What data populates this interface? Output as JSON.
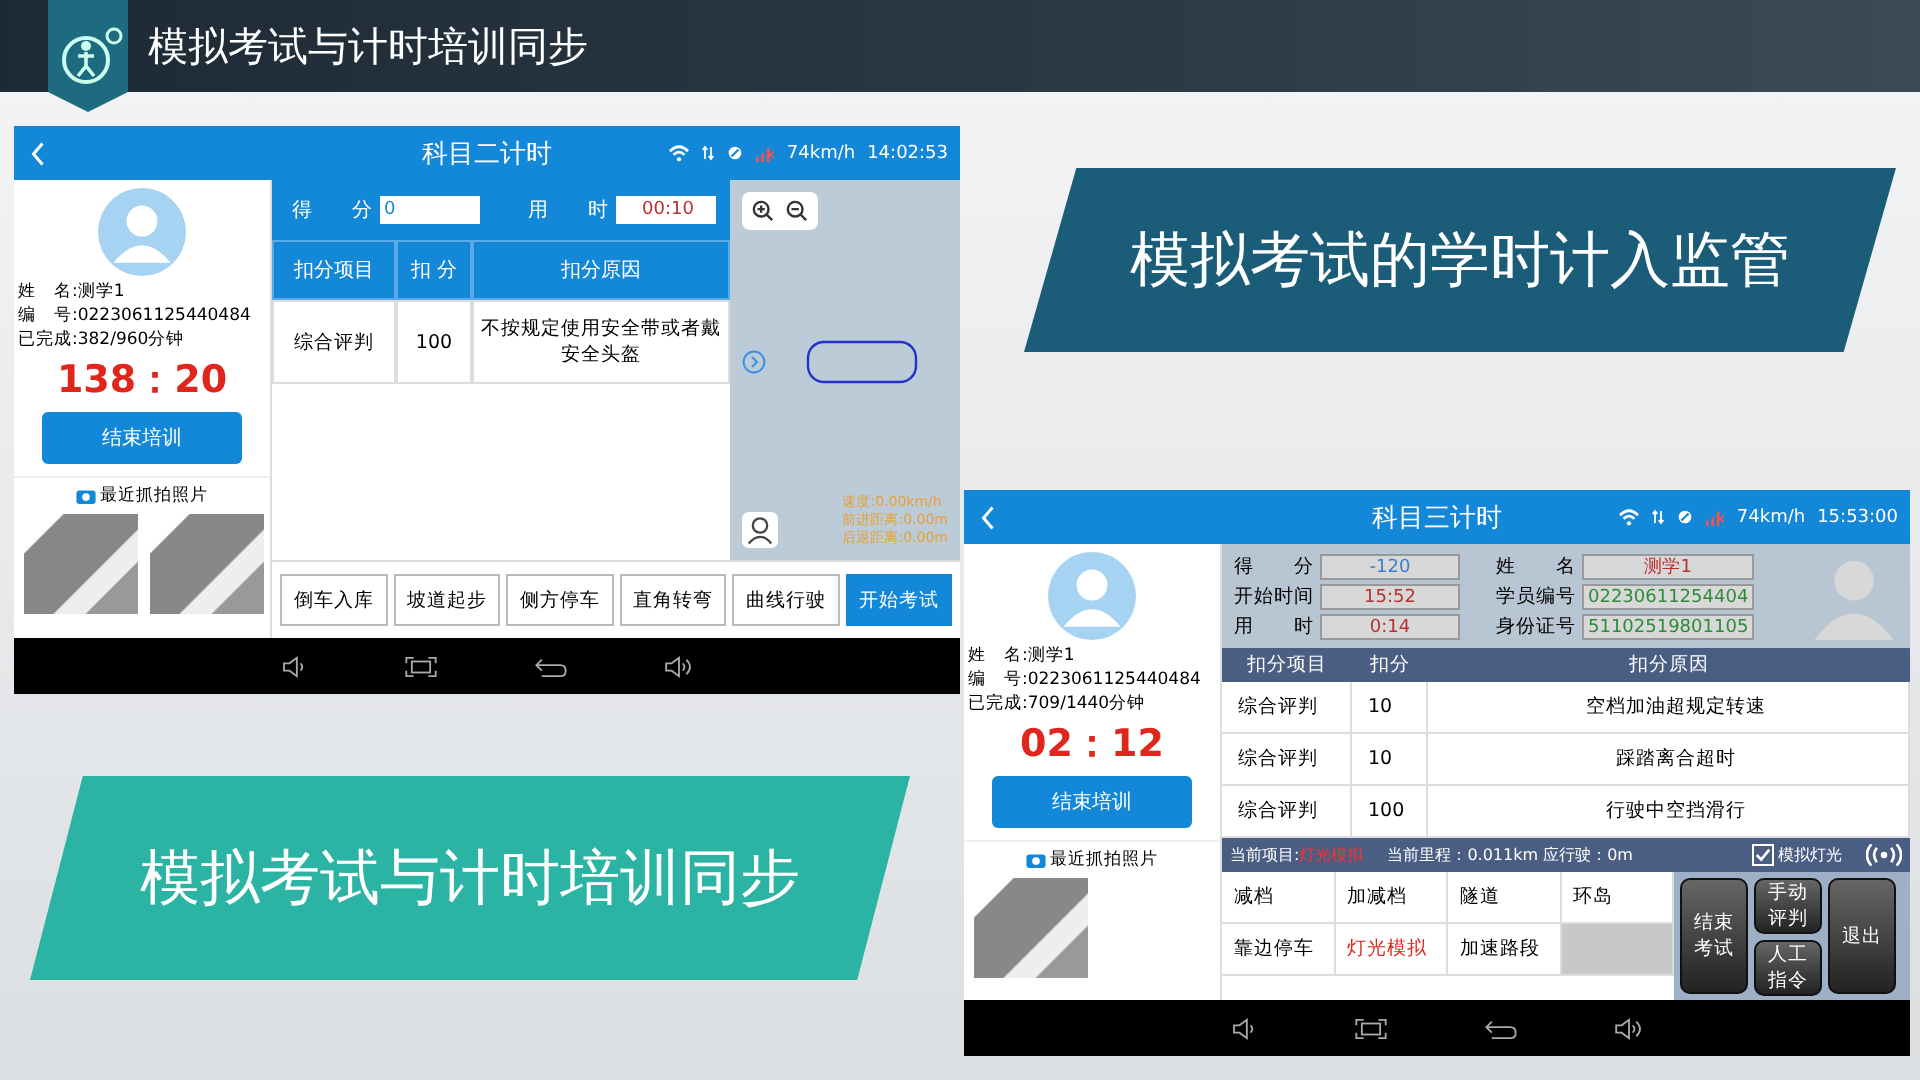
{
  "slide": {
    "title": "模拟考试与计时培训同步"
  },
  "callouts": [
    {
      "kind": "dark",
      "text": "模拟考试的学时计入监管"
    },
    {
      "kind": "teal",
      "text": "模拟考试与计时培训同步"
    }
  ],
  "screen_1": {
    "title": "科目二计时",
    "speed": "74km/h",
    "time": "14:02:53",
    "student": [
      "姓　名:测学1",
      "编　号:0223061125440484",
      "已完成:382/960分钟"
    ],
    "timer": "138：20",
    "end_button": "结束培训",
    "photos_label": "最近抓拍照片",
    "score_label": "得　　分",
    "score": "0",
    "used_label": "用　　时",
    "used": "00:10",
    "columns": [
      "扣分项目",
      "扣 分",
      "扣分原因"
    ],
    "rows": [
      [
        "综合评判",
        "100",
        "不按规定使用安全带或者戴安全头盔"
      ]
    ],
    "map_readouts": [
      "速度:0.00km/h",
      "前进距离:0.00m",
      "后退距离:0.00m"
    ],
    "actions": [
      {
        "label": "倒车入库",
        "kind": "plain"
      },
      {
        "label": "坡道起步",
        "kind": "plain"
      },
      {
        "label": "侧方停车",
        "kind": "plain"
      },
      {
        "label": "直角转弯",
        "kind": "plain"
      },
      {
        "label": "曲线行驶",
        "kind": "plain"
      },
      {
        "label": "开始考试",
        "kind": "primary"
      }
    ]
  },
  "screen_2": {
    "title": "科目三计时",
    "speed": "74km/h",
    "time": "15:53:00",
    "student": [
      "姓　名:测学1",
      "编　号:0223061125440484",
      "已完成:709/1440分钟"
    ],
    "timer": "02：12",
    "end_button": "结束培训",
    "photos_label": "最近抓拍照片",
    "info": [
      {
        "label": "得　　分",
        "value": "-120",
        "color": "#3a7fd0"
      },
      {
        "label": "开始时间",
        "value": "15:52",
        "color": "#b83030"
      },
      {
        "label": "用　　时",
        "value": "0:14",
        "color": "#b83030"
      },
      {
        "label": "姓　　名",
        "value": "测学1",
        "color": "#b83030"
      },
      {
        "label": "学员编号",
        "value": "02230611254404",
        "color": "#2e8b3a"
      },
      {
        "label": "身份证号",
        "value": "51102519801105",
        "color": "#2e8b3a"
      }
    ],
    "columns": [
      "扣分项目",
      "扣分",
      "扣分原因"
    ],
    "rows": [
      [
        "综合评判",
        "10",
        "空档加油超规定转速"
      ],
      [
        "综合评判",
        "10",
        "踩踏离合超时"
      ],
      [
        "综合评判",
        "100",
        "行驶中空挡滑行"
      ]
    ],
    "current_label": "当前项目:",
    "current_item": "灯光模拟",
    "mileage": "当前里程：0.011km 应行驶：0m",
    "sim_light": {
      "label": "模拟灯光",
      "checked": true
    },
    "items": [
      {
        "label": "减档",
        "selected": false
      },
      {
        "label": "加减档",
        "selected": false
      },
      {
        "label": "隧道",
        "selected": false
      },
      {
        "label": "环岛",
        "selected": false
      },
      {
        "label": "靠边停车",
        "selected": false
      },
      {
        "label": "灯光模拟",
        "selected": true
      },
      {
        "label": "加速路段",
        "selected": false
      }
    ],
    "buttons": [
      "结束考试",
      "手动评判",
      "人工指令",
      "退出"
    ]
  }
}
